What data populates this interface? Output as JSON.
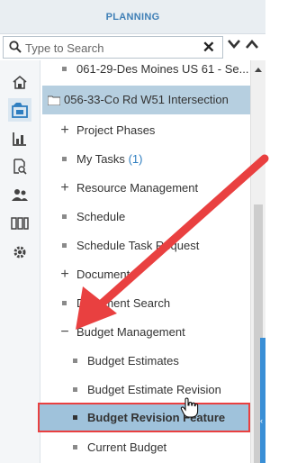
{
  "panel": {
    "title": "PLANNING",
    "search_placeholder": "Type to Search",
    "clear_symbol": "✕",
    "icons": {
      "search": "search-icon",
      "collapse_down": "chevron-down-icon",
      "collapse_up": "chevron-up-icon"
    }
  },
  "rail": [
    {
      "icon": "home-icon"
    },
    {
      "icon": "project-icon",
      "active": true
    },
    {
      "icon": "building-chart-icon"
    },
    {
      "icon": "document-search-icon"
    },
    {
      "icon": "people-icon"
    },
    {
      "icon": "columns-icon"
    },
    {
      "icon": "gear-icon"
    }
  ],
  "tree": {
    "items": [
      {
        "label": "061-29-Des Moines US 61 - Se...",
        "kind": "bullet"
      },
      {
        "label": "056-33-Co Rd W51 Intersection",
        "kind": "folder",
        "selected": true
      },
      {
        "label": "Project Phases",
        "kind": "plus"
      },
      {
        "label": "My Tasks",
        "badge": "(1)",
        "kind": "bullet"
      },
      {
        "label": "Resource Management",
        "kind": "plus"
      },
      {
        "label": "Schedule",
        "kind": "bullet"
      },
      {
        "label": "Schedule Task Request",
        "kind": "bullet"
      },
      {
        "label": "Documents",
        "kind": "plus"
      },
      {
        "label": "Document Search",
        "kind": "bullet"
      },
      {
        "label": "Budget Management",
        "kind": "minus"
      },
      {
        "label": "Budget Estimates",
        "kind": "bullet"
      },
      {
        "label": "Budget Estimate Revision",
        "kind": "bullet"
      },
      {
        "label": "Budget Revision Feature",
        "kind": "bullet",
        "highlighted": true
      },
      {
        "label": "Current Budget",
        "kind": "bullet"
      }
    ]
  },
  "colors": {
    "accent": "#3f7fb6",
    "highlight_border": "#e94040",
    "selected_bg": "#b6cfe0",
    "annotation_arrow": "#e94040"
  }
}
